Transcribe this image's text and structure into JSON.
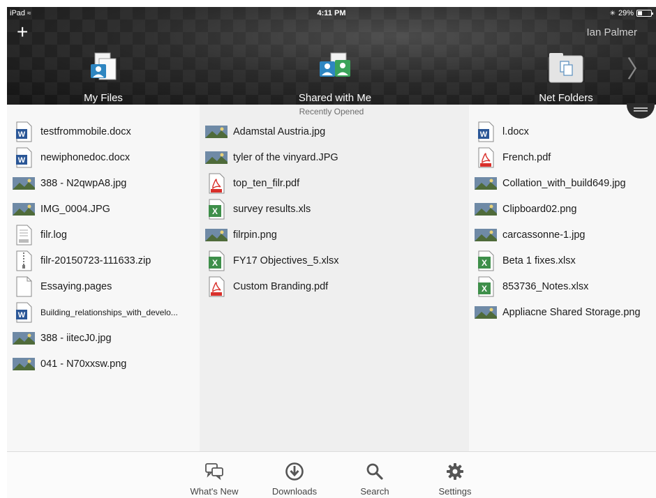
{
  "status_bar": {
    "carrier": "iPad",
    "time": "4:11 PM",
    "battery_text": "29%",
    "battery_level": 0.29
  },
  "header": {
    "add_icon": "plus-icon",
    "user_name": "Ian Palmer",
    "tiles": [
      {
        "label": "My Files",
        "icon": "my-files-icon"
      },
      {
        "label": "Shared with Me",
        "icon": "shared-with-me-icon"
      },
      {
        "label": "Net Folders",
        "icon": "net-folders-icon"
      }
    ],
    "next_icon": "chevron-right-icon"
  },
  "recent": {
    "title": "Recently Opened",
    "columns": [
      [
        {
          "name": "testfrommobile.docx",
          "icon": "word-icon"
        },
        {
          "name": "newiphonedoc.docx",
          "icon": "word-icon"
        },
        {
          "name": "388 - N2qwpA8.jpg",
          "icon": "image-thumb-icon"
        },
        {
          "name": "IMG_0004.JPG",
          "icon": "image-thumb-icon"
        },
        {
          "name": "filr.log",
          "icon": "text-file-icon"
        },
        {
          "name": "filr-20150723-111633.zip",
          "icon": "zip-icon"
        },
        {
          "name": "Essaying.pages",
          "icon": "generic-file-icon"
        },
        {
          "name": "Building_relationships_with_develo...",
          "icon": "word-icon"
        },
        {
          "name": "388 - iitecJ0.jpg",
          "icon": "image-thumb-icon"
        },
        {
          "name": "041 - N70xxsw.png",
          "icon": "image-thumb-icon"
        }
      ],
      [
        {
          "name": "Adamstal Austria.jpg",
          "icon": "image-thumb-icon"
        },
        {
          "name": "tyler of the vinyard.JPG",
          "icon": "image-thumb-icon"
        },
        {
          "name": "top_ten_filr.pdf",
          "icon": "pdf-icon"
        },
        {
          "name": "survey results.xls",
          "icon": "excel-icon"
        },
        {
          "name": "filrpin.png",
          "icon": "image-thumb-icon"
        },
        {
          "name": "FY17 Objectives_5.xlsx",
          "icon": "excel-icon"
        },
        {
          "name": "Custom Branding.pdf",
          "icon": "pdf-icon"
        }
      ],
      [
        {
          "name": "l.docx",
          "icon": "word-icon"
        },
        {
          "name": "French.pdf",
          "icon": "pdf-icon"
        },
        {
          "name": "Collation_with_build649.jpg",
          "icon": "image-thumb-icon"
        },
        {
          "name": "Clipboard02.png",
          "icon": "image-thumb-icon"
        },
        {
          "name": "carcassonne-1.jpg",
          "icon": "image-thumb-icon"
        },
        {
          "name": "Beta 1 fixes.xlsx",
          "icon": "excel-icon"
        },
        {
          "name": "853736_Notes.xlsx",
          "icon": "excel-icon"
        },
        {
          "name": "Appliacne Shared Storage.png",
          "icon": "image-thumb-icon"
        }
      ]
    ]
  },
  "tab_bar": [
    {
      "label": "What's New",
      "icon": "whats-new-icon"
    },
    {
      "label": "Downloads",
      "icon": "download-icon"
    },
    {
      "label": "Search",
      "icon": "search-icon"
    },
    {
      "label": "Settings",
      "icon": "gear-icon"
    }
  ],
  "colors": {
    "header_bg": "#1c1c1c",
    "word_blue": "#2b5797",
    "pdf_red": "#d9302b",
    "excel_green": "#3e8f4a",
    "tile_person_blue": "#2e86c1",
    "tile_person_green": "#3aa35a"
  }
}
